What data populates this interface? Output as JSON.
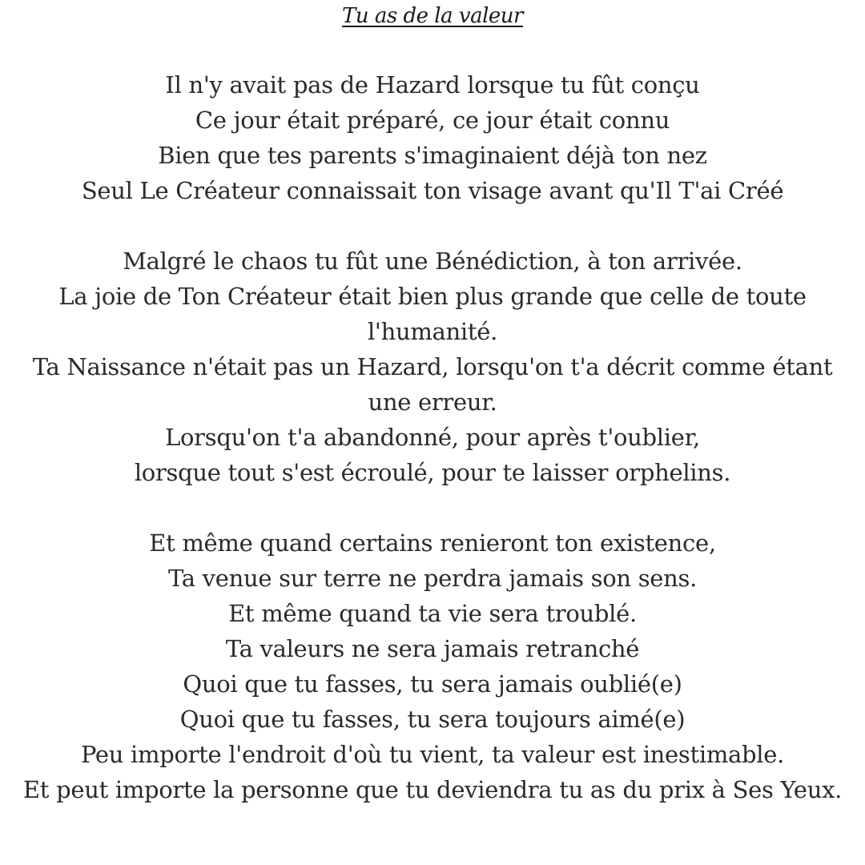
{
  "title": "Tu as de la valeur",
  "stanzas": [
    {
      "lines": [
        "Il n'y avait pas de Hazard lorsque tu fût conçu",
        "Ce jour était préparé, ce jour était connu",
        "Bien que tes parents s'imaginaient déjà ton nez",
        "Seul Le Créateur connaissait ton visage avant qu'Il T'ai Créé"
      ]
    },
    {
      "lines": [
        "Malgré le chaos tu fût une Bénédiction, à ton arrivée.",
        "La joie de Ton Créateur était bien plus grande que celle de toute l'humanité.",
        "Ta Naissance n'était pas un Hazard, lorsqu'on t'a décrit comme étant une erreur.",
        "Lorsqu'on t'a abandonné, pour après t'oublier,",
        "lorsque tout s'est écroulé, pour te laisser orphelins."
      ]
    },
    {
      "lines": [
        "Et même quand certains renieront ton existence,",
        "Ta venue sur terre ne perdra jamais son sens.",
        "Et même quand ta vie sera troublé.",
        "Ta valeurs ne sera jamais retranché",
        "Quoi que tu fasses, tu sera jamais oublié(e)",
        "Quoi que tu fasses, tu sera toujours aimé(e)",
        "Peu importe l'endroit d'où tu vient, ta valeur est inestimable.",
        "Et peut importe la personne que tu deviendra  tu as du prix à Ses Yeux."
      ]
    }
  ]
}
